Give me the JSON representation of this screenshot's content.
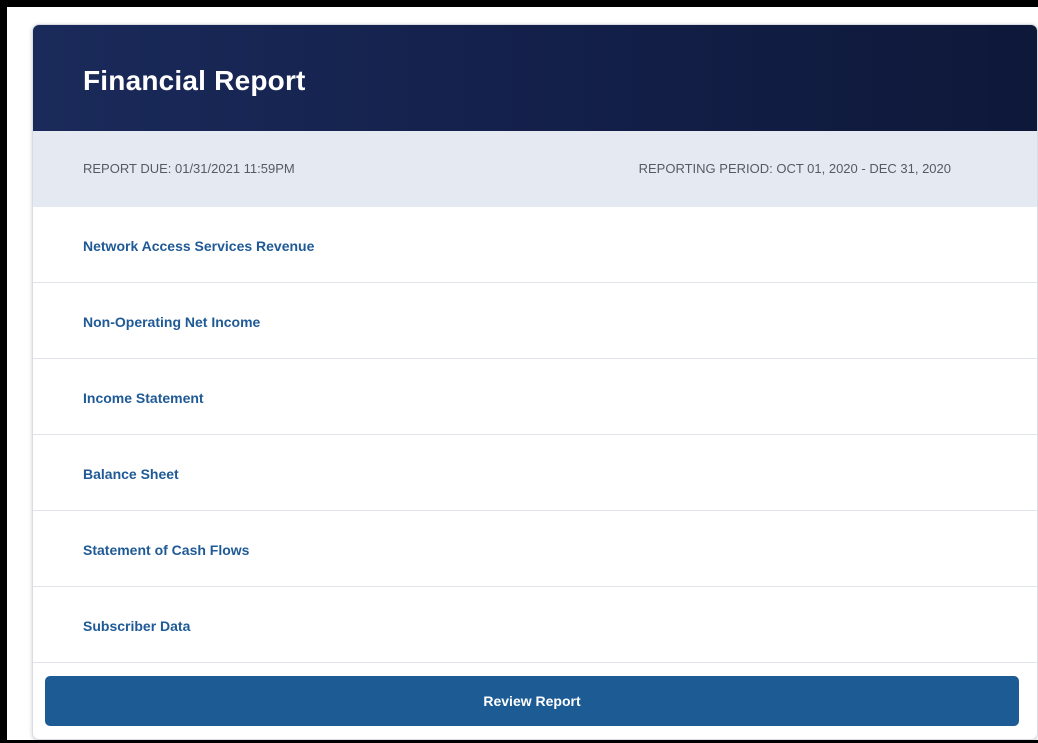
{
  "header": {
    "title": "Financial Report"
  },
  "meta": {
    "report_due": "REPORT DUE: 01/31/2021 11:59PM",
    "reporting_period": "REPORTING PERIOD: OCT 01, 2020 - DEC 31, 2020"
  },
  "sections": [
    {
      "label": "Network Access Services Revenue"
    },
    {
      "label": "Non-Operating Net Income"
    },
    {
      "label": "Income Statement"
    },
    {
      "label": "Balance Sheet"
    },
    {
      "label": "Statement of Cash Flows"
    },
    {
      "label": "Subscriber Data"
    }
  ],
  "footer": {
    "review_label": "Review Report"
  },
  "colors": {
    "header_bg": "#14214c",
    "meta_bg": "#e5eaf2",
    "link": "#1f5a96",
    "button_bg": "#1d5b94"
  }
}
